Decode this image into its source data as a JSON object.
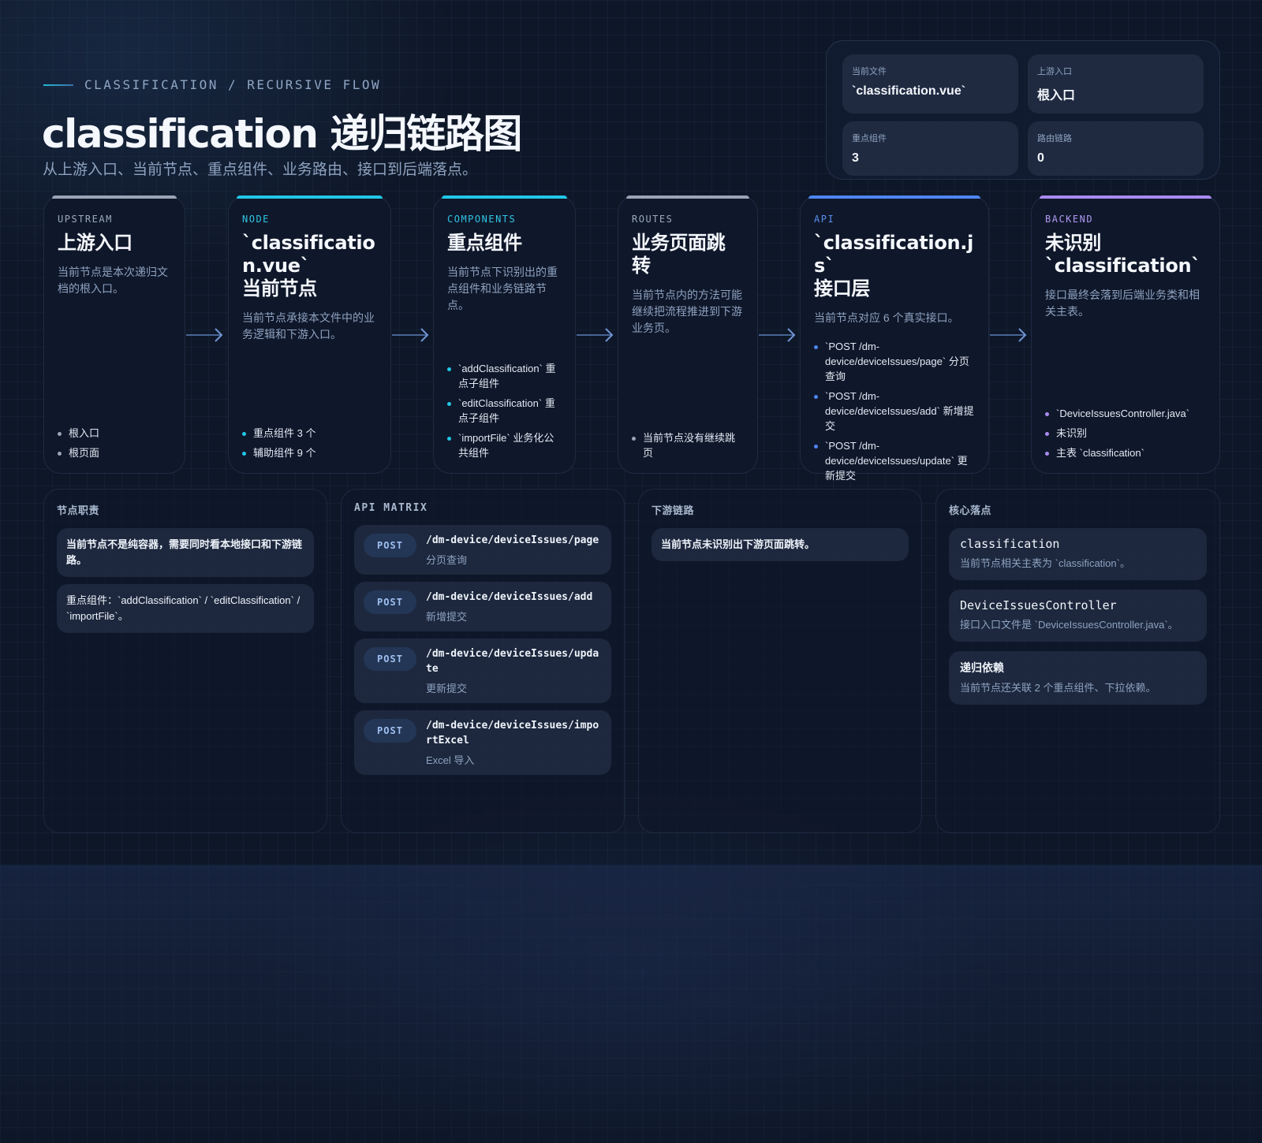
{
  "header": {
    "eyebrow": "CLASSIFICATION / RECURSIVE FLOW",
    "title": "classification 递归链路图",
    "subtitle": "从上游入口、当前节点、重点组件、业务路由、接口到后端落点。"
  },
  "stats": [
    {
      "label": "当前文件",
      "value": "`classification.vue`"
    },
    {
      "label": "上游入口",
      "value": "根入口"
    },
    {
      "label": "重点组件",
      "value": "3"
    },
    {
      "label": "路由链路",
      "value": "0"
    }
  ],
  "flow": {
    "upstream": {
      "tag": "UPSTREAM",
      "title": "上游入口",
      "desc": "当前节点是本次递归文档的根入口。",
      "bullets": [
        "根入口",
        "根页面"
      ]
    },
    "node": {
      "tag": "NODE",
      "title_line1": "`classification.vue`",
      "title_line2": "当前节点",
      "desc": "当前节点承接本文件中的业务逻辑和下游入口。",
      "bullets": [
        "重点组件 3 个",
        "辅助组件 9 个"
      ]
    },
    "components": {
      "tag": "COMPONENTS",
      "title": "重点组件",
      "desc": "当前节点下识别出的重点组件和业务链路节点。",
      "bullets": [
        "`addClassification` 重点子组件",
        "`editClassification` 重点子组件",
        "`importFile` 业务化公共组件"
      ]
    },
    "routes": {
      "tag": "ROUTES",
      "title": "业务页面跳转",
      "desc": "当前节点内的方法可能继续把流程推进到下游业务页。",
      "bullets": [
        "当前节点没有继续跳页"
      ]
    },
    "api": {
      "tag": "API",
      "title_line1": "`classification.js`",
      "title_line2": "接口层",
      "desc": "当前节点对应 6 个真实接口。",
      "bullets": [
        "`POST /dm-device/deviceIssues/page` 分页查询",
        "`POST /dm-device/deviceIssues/add` 新增提交",
        "`POST /dm-device/deviceIssues/update` 更新提交"
      ]
    },
    "backend": {
      "tag": "BACKEND",
      "title_line1": "未识别",
      "title_line2": "`classification`",
      "desc": "接口最终会落到后端业务类和相关主表。",
      "bullets": [
        "`DeviceIssuesController.java`",
        "未识别",
        "主表 `classification`"
      ]
    }
  },
  "panels": {
    "duties": {
      "title": "节点职责",
      "notes": [
        "当前节点不是纯容器，需要同时看本地接口和下游链路。",
        "重点组件：`addClassification` / `editClassification` / `importFile`。"
      ]
    },
    "api_matrix": {
      "title": "API MATRIX",
      "rows": [
        {
          "method": "POST",
          "path": "/dm-device/deviceIssues/page",
          "desc": "分页查询"
        },
        {
          "method": "POST",
          "path": "/dm-device/deviceIssues/add",
          "desc": "新增提交"
        },
        {
          "method": "POST",
          "path": "/dm-device/deviceIssues/update",
          "desc": "更新提交"
        },
        {
          "method": "POST",
          "path": "/dm-device/deviceIssues/importExcel",
          "desc": "Excel 导入"
        }
      ]
    },
    "downstream": {
      "title": "下游链路",
      "notes": [
        "当前节点未识别出下游页面跳转。"
      ]
    },
    "core": {
      "title": "核心落点",
      "items": [
        {
          "name": "classification",
          "desc": "当前节点相关主表为 `classification`。"
        },
        {
          "name": "DeviceIssuesController",
          "desc": "接口入口文件是 `DeviceIssuesController.java`。"
        },
        {
          "name": "递归依赖",
          "desc": "当前节点还关联 2 个重点组件、下拉依赖。"
        }
      ]
    }
  }
}
